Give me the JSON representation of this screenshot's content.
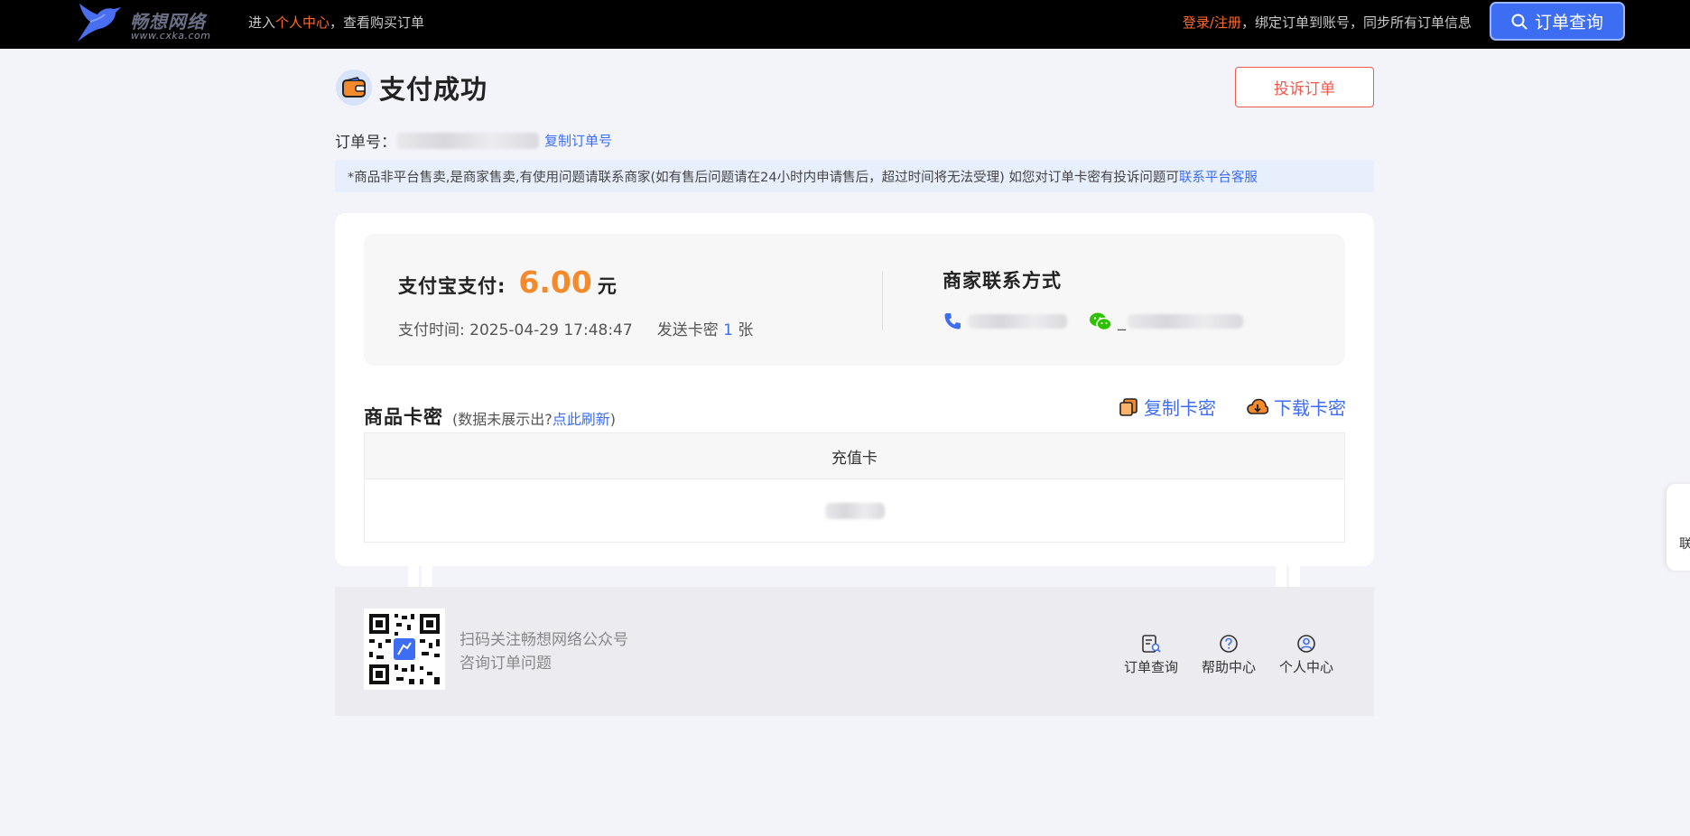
{
  "header": {
    "logo_name": "畅想网络",
    "logo_url": "www.cxka.com",
    "intro_prefix": "进入",
    "intro_link": "个人中心",
    "intro_suffix": "，查看购买订单",
    "login_link": "登录/注册",
    "login_suffix": "，绑定订单到账号，同步所有订单信息",
    "order_query_label": "订单查询"
  },
  "page": {
    "title": "支付成功",
    "complain_label": "投诉订单",
    "order_no_label": "订单号：",
    "copy_order_label": "复制订单号",
    "notice_text": "*商品非平台售卖,是商家售卖,有使用问题请联系商家(如有售后问题请在24小时内申请售后，超过时间将无法受理) 如您对订单卡密有投诉问题可",
    "notice_link": "联系平台客服"
  },
  "payment": {
    "method_label": "支付宝支付:",
    "amount": "6.00",
    "unit": "元",
    "time_label": "支付时间:",
    "time_value": "2025-04-29 17:48:47",
    "sent_label": "发送卡密",
    "sent_count": "1",
    "sent_unit": "张",
    "merchant_title": "商家联系方式",
    "wechat_prefix": "_"
  },
  "cards": {
    "title": "商品卡密",
    "hint_prefix": "(数据未展示出?",
    "hint_link": "点此刷新",
    "hint_suffix": ")",
    "copy_label": "复制卡密",
    "download_label": "下载卡密",
    "column_header": "充值卡"
  },
  "footer": {
    "line1": "扫码关注畅想网络公众号",
    "line2": "咨询订单问题",
    "nav": [
      "订单查询",
      "帮助中心",
      "个人中心"
    ]
  },
  "side_tab": {
    "label": "联"
  },
  "colors": {
    "accent": "#3d6df2",
    "orange": "#f58a2c",
    "danger": "#ee5a4e"
  }
}
